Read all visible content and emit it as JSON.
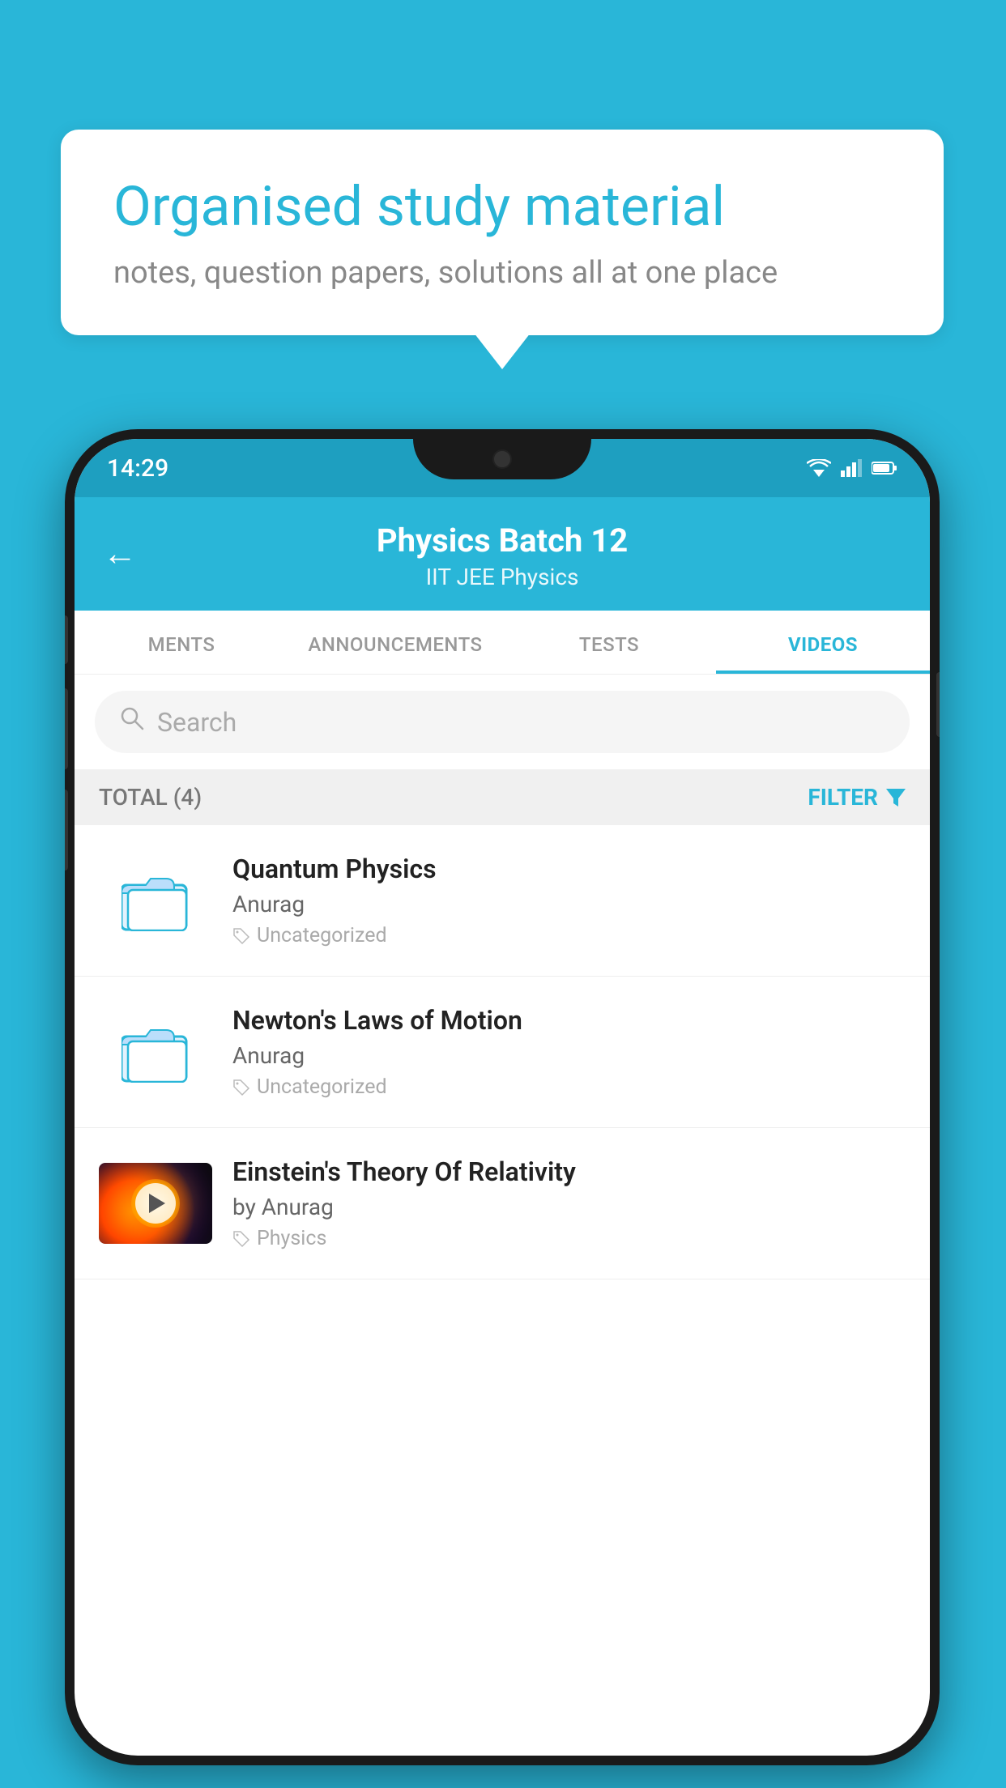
{
  "background_color": "#29b6d8",
  "speech_bubble": {
    "title": "Organised study material",
    "subtitle": "notes, question papers, solutions all at one place"
  },
  "phone": {
    "status_bar": {
      "time": "14:29"
    },
    "header": {
      "title": "Physics Batch 12",
      "subtitle": "IIT JEE   Physics",
      "back_label": "←"
    },
    "tabs": [
      {
        "label": "MENTS",
        "active": false
      },
      {
        "label": "ANNOUNCEMENTS",
        "active": false
      },
      {
        "label": "TESTS",
        "active": false
      },
      {
        "label": "VIDEOS",
        "active": true
      }
    ],
    "search": {
      "placeholder": "Search"
    },
    "filter_row": {
      "total_label": "TOTAL (4)",
      "filter_label": "FILTER"
    },
    "videos": [
      {
        "id": "v1",
        "title": "Quantum Physics",
        "author": "Anurag",
        "tag": "Uncategorized",
        "type": "folder"
      },
      {
        "id": "v2",
        "title": "Newton's Laws of Motion",
        "author": "Anurag",
        "tag": "Uncategorized",
        "type": "folder"
      },
      {
        "id": "v3",
        "title": "Einstein's Theory Of Relativity",
        "author": "by Anurag",
        "tag": "Physics",
        "type": "video"
      }
    ]
  }
}
